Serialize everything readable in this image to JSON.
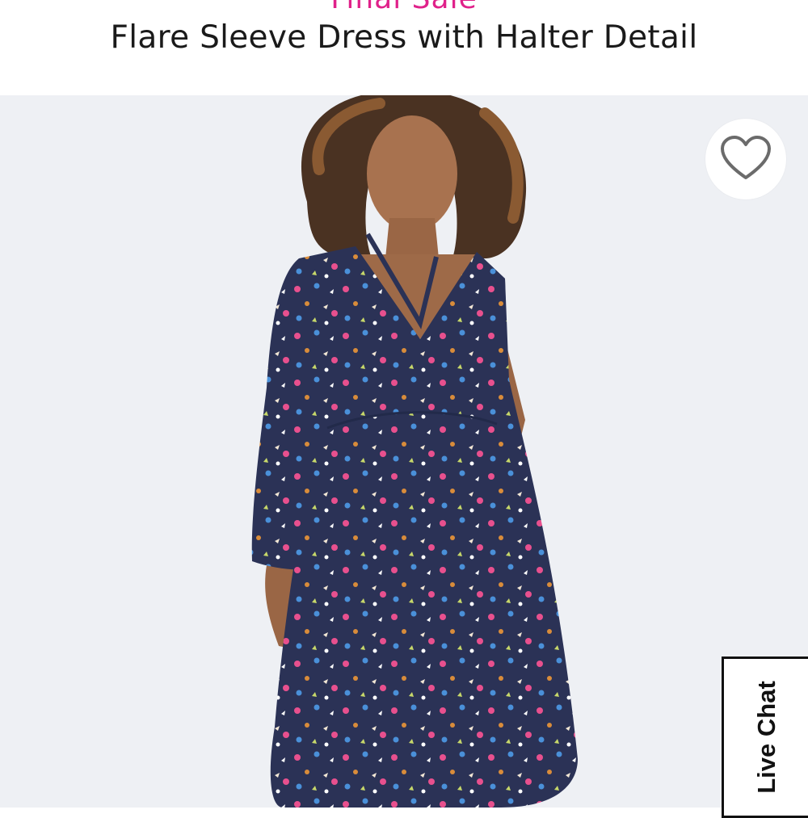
{
  "header": {
    "sale_label": "Final Sale",
    "title": "Flare Sleeve Dress with Halter Detail"
  },
  "product_image": {
    "alt": "Model wearing navy floral print flare sleeve dress with halter detail"
  },
  "favorite": {
    "icon": "heart-outline-icon"
  },
  "live_chat": {
    "label": "Live Chat"
  },
  "colors": {
    "sale_accent": "#e0218a",
    "dress_navy": "#2b3256",
    "background": "#eef0f4"
  }
}
